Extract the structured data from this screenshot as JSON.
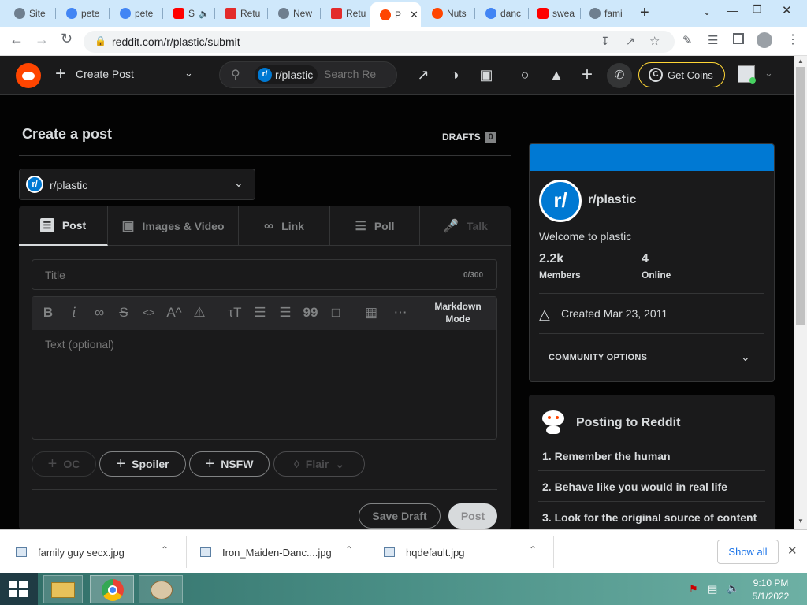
{
  "browser": {
    "tabs": [
      {
        "label": "Site",
        "color": "#6f7f8f"
      },
      {
        "label": "pete",
        "color": "#4285f4"
      },
      {
        "label": "pete",
        "color": "#4285f4"
      },
      {
        "label": "S",
        "color": "#ff0000"
      },
      {
        "label": "Retu",
        "color": "#e32b2b"
      },
      {
        "label": "New",
        "color": "#6f7f8f"
      },
      {
        "label": "Retu",
        "color": "#e32b2b"
      },
      {
        "label": "P",
        "color": "#ff4500"
      },
      {
        "label": "Nuts",
        "color": "#ff4500"
      },
      {
        "label": "danc",
        "color": "#4285f4"
      },
      {
        "label": "swea",
        "color": "#ff0000"
      },
      {
        "label": "fami",
        "color": "#6f7f8f"
      }
    ],
    "url": "reddit.com/r/plastic/submit"
  },
  "header": {
    "create_post": "Create Post",
    "search_chip": "r/plastic",
    "search_placeholder": "Search Re",
    "get_coins": "Get Coins"
  },
  "page": {
    "title": "Create a post",
    "drafts_label": "DRAFTS",
    "drafts_count": "0",
    "community_select": "r/plastic",
    "tabs": [
      "Post",
      "Images & Video",
      "Link",
      "Poll",
      "Talk"
    ],
    "title_placeholder": "Title",
    "title_counter": "0/300",
    "markdown_mode": "Markdown Mode",
    "text_placeholder": "Text (optional)",
    "tags": {
      "oc": "OC",
      "spoiler": "Spoiler",
      "nsfw": "NSFW",
      "flair": "Flair"
    },
    "save_draft": "Save Draft",
    "post": "Post"
  },
  "sidebar": {
    "community_name": "r/plastic",
    "welcome": "Welcome to plastic",
    "members_value": "2.2k",
    "members_label": "Members",
    "online_value": "4",
    "online_label": "Online",
    "created": "Created Mar 23, 2011",
    "community_options": "COMMUNITY OPTIONS",
    "posting_title": "Posting to Reddit",
    "rules": [
      "1. Remember the human",
      "2. Behave like you would in real life",
      "3. Look for the original source of content"
    ]
  },
  "downloads": {
    "items": [
      "family guy secx.jpg",
      "Iron_Maiden-Danc....jpg",
      "hqdefault.jpg"
    ],
    "show_all": "Show all"
  },
  "taskbar": {
    "time": "9:10 PM",
    "date": "5/1/2022"
  },
  "colors": {
    "reddit_orange": "#ff4500",
    "community_banner": "#0079d3",
    "coins_border": "#ffd635"
  }
}
